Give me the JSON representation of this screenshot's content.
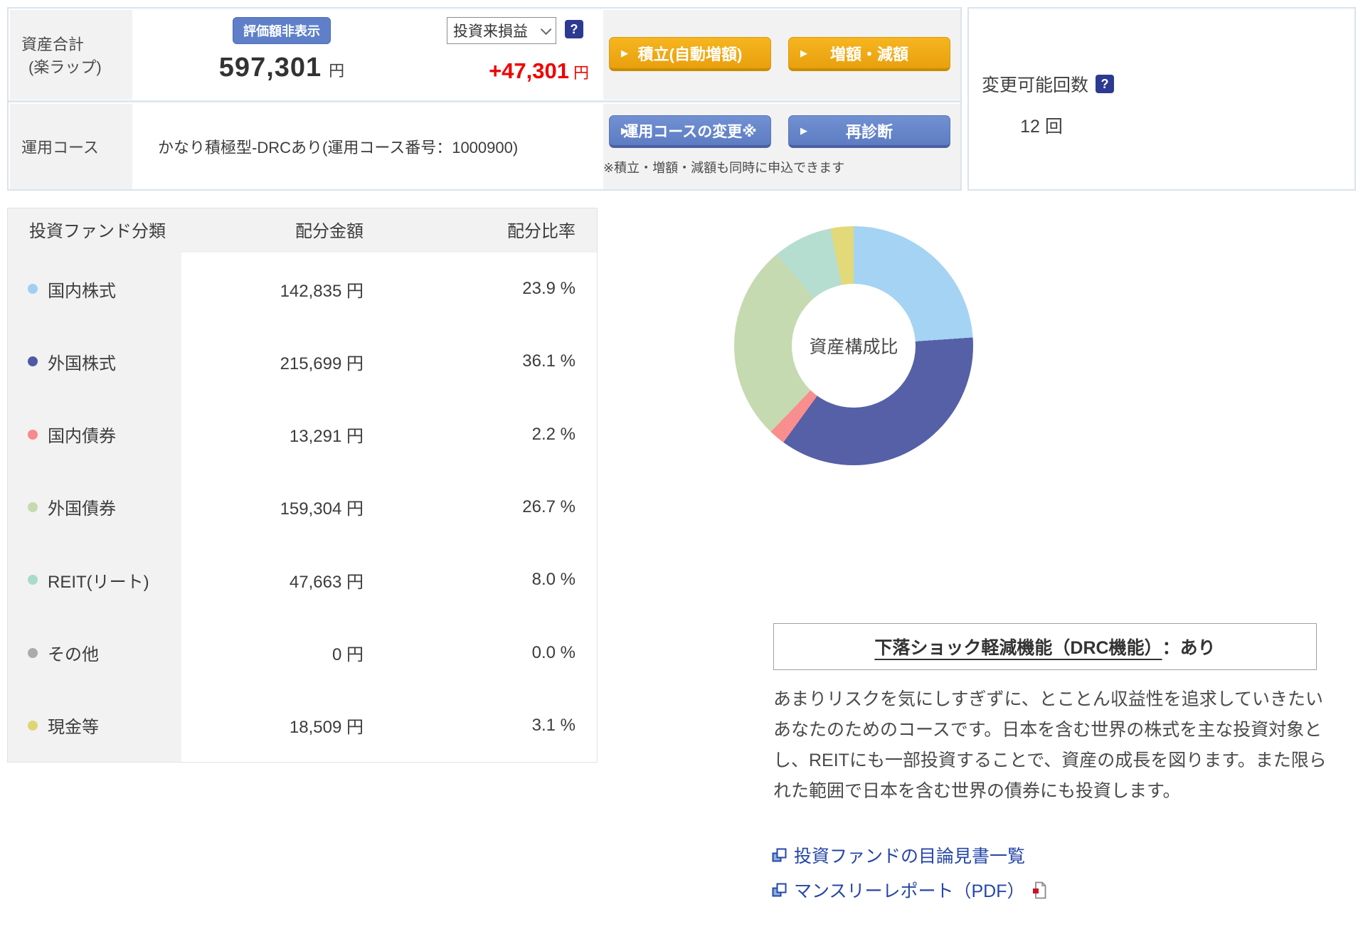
{
  "header": {
    "asset_total": {
      "label_line1": "資産合計",
      "label_line2": "(楽ラップ)",
      "hide_value_button": "評価額非表示",
      "amount": "597,301",
      "amount_unit": "円",
      "period_select_value": "投資来損益",
      "profit": "+47,301",
      "profit_unit": "円",
      "tsumitate_button": "積立(自動増額)",
      "zougaku_button": "増額・減額"
    },
    "course": {
      "label": "運用コース",
      "value": "かなり積極型-DRCあり(運用コース番号：1000900)",
      "change_course_button": "運用コースの変更※",
      "rediagnosis_button": "再診断",
      "note": "※積立・増額・減額も同時に申込できます"
    },
    "change_count": {
      "label": "変更可能回数",
      "value": "12 回"
    }
  },
  "allocation_table": {
    "columns": [
      "投資ファンド分類",
      "配分金額",
      "配分比率"
    ],
    "rows": [
      {
        "label": "国内株式",
        "color": "#9fcff3",
        "amount": "142,835 円",
        "ratio": "23.9 %"
      },
      {
        "label": "外国株式",
        "color": "#5059a4",
        "amount": "215,699 円",
        "ratio": "36.1 %"
      },
      {
        "label": "国内債券",
        "color": "#f8898c",
        "amount": "13,291 円",
        "ratio": "2.2 %"
      },
      {
        "label": "外国債券",
        "color": "#c5dab0",
        "amount": "159,304 円",
        "ratio": "26.7 %"
      },
      {
        "label": "REIT(リート)",
        "color": "#a8dcc8",
        "amount": "47,663 円",
        "ratio": "8.0 %"
      },
      {
        "label": "その他",
        "color": "#ababab",
        "amount": "0 円",
        "ratio": "0.0 %"
      },
      {
        "label": "現金等",
        "color": "#ded672",
        "amount": "18,509 円",
        "ratio": "3.1 %"
      }
    ]
  },
  "chart_data": {
    "type": "pie",
    "title": "資産構成比",
    "center_label": "資産構成比",
    "categories": [
      "国内株式",
      "外国株式",
      "国内債券",
      "外国債券",
      "REIT(リート)",
      "その他",
      "現金等"
    ],
    "values": [
      23.9,
      36.1,
      2.2,
      26.7,
      8.0,
      0.0,
      3.1
    ],
    "colors": [
      "#a5d3f3",
      "#5560a7",
      "#f98e8e",
      "#c5dab0",
      "#b5ded0",
      "#ababab",
      "#e2d978"
    ],
    "legend_position": "none",
    "donut_hole_ratio": 0.52
  },
  "drc": {
    "title": "下落ショック軽減機能（DRC機能）",
    "title_suffix": "：あり",
    "description": "あまりリスクを気にしすぎずに、とことん収益性を追求していきたいあなたのためのコースです。日本を含む世界の株式を主な投資対象とし、REITにも一部投資することで、資産の成長を図ります。また限られた範囲で日本を含む世界の債券にも投資します。"
  },
  "links": [
    {
      "label": "投資ファンドの目論見書一覧"
    },
    {
      "label": "マンスリーレポート（PDF）"
    }
  ],
  "icons": {
    "help_glyph": "?",
    "button_arrow": "▶"
  },
  "colors": {
    "accent_orange": "#f0a913",
    "accent_blue": "#6585c9",
    "link_blue": "#2546a8",
    "profit_red": "#f00000",
    "panel_border": "#d9e3ec",
    "cell_gray": "#f2f2f2"
  }
}
